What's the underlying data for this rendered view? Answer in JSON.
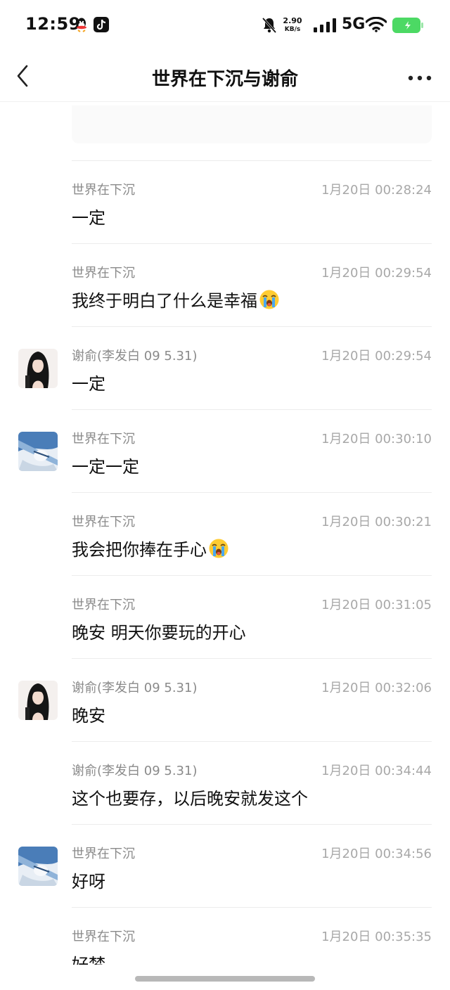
{
  "status_bar": {
    "time": "12:59",
    "net_speed_value": "2.90",
    "net_speed_unit": "KB/s",
    "network_type": "5G",
    "battery_color": "#4cd964",
    "icons": [
      "qq-icon",
      "tiktok-icon",
      "bell-muted-icon",
      "signal-icon",
      "wifi-icon",
      "battery-icon"
    ]
  },
  "header": {
    "title": "世界在下沉与谢俞"
  },
  "messages": [
    {
      "sender": "世界在下沉",
      "time": "1月20日 00:28:24",
      "text": "一定",
      "emoji": false,
      "avatar": "none"
    },
    {
      "sender": "世界在下沉",
      "time": "1月20日 00:29:54",
      "text": "我终于明白了什么是幸福",
      "emoji": true,
      "avatar": "none"
    },
    {
      "sender": "谢俞(李发白 09 5.31)",
      "time": "1月20日 00:29:54",
      "text": "一定",
      "emoji": false,
      "avatar": "dark-hair"
    },
    {
      "sender": "世界在下沉",
      "time": "1月20日 00:30:10",
      "text": "一定一定",
      "emoji": false,
      "avatar": "blue-hair"
    },
    {
      "sender": "世界在下沉",
      "time": "1月20日 00:30:21",
      "text": "我会把你捧在手心",
      "emoji": true,
      "avatar": "none"
    },
    {
      "sender": "世界在下沉",
      "time": "1月20日 00:31:05",
      "text": "晚安 明天你要玩的开心",
      "emoji": false,
      "avatar": "none"
    },
    {
      "sender": "谢俞(李发白 09 5.31)",
      "time": "1月20日 00:32:06",
      "text": "晚安",
      "emoji": false,
      "avatar": "dark-hair"
    },
    {
      "sender": "谢俞(李发白 09 5.31)",
      "time": "1月20日 00:34:44",
      "text": "这个也要存，以后晚安就发这个",
      "emoji": false,
      "avatar": "none"
    },
    {
      "sender": "世界在下沉",
      "time": "1月20日 00:34:56",
      "text": "好呀",
      "emoji": false,
      "avatar": "blue-hair"
    },
    {
      "sender": "世界在下沉",
      "time": "1月20日 00:35:35",
      "text": "好梦",
      "emoji": false,
      "avatar": "none"
    }
  ]
}
